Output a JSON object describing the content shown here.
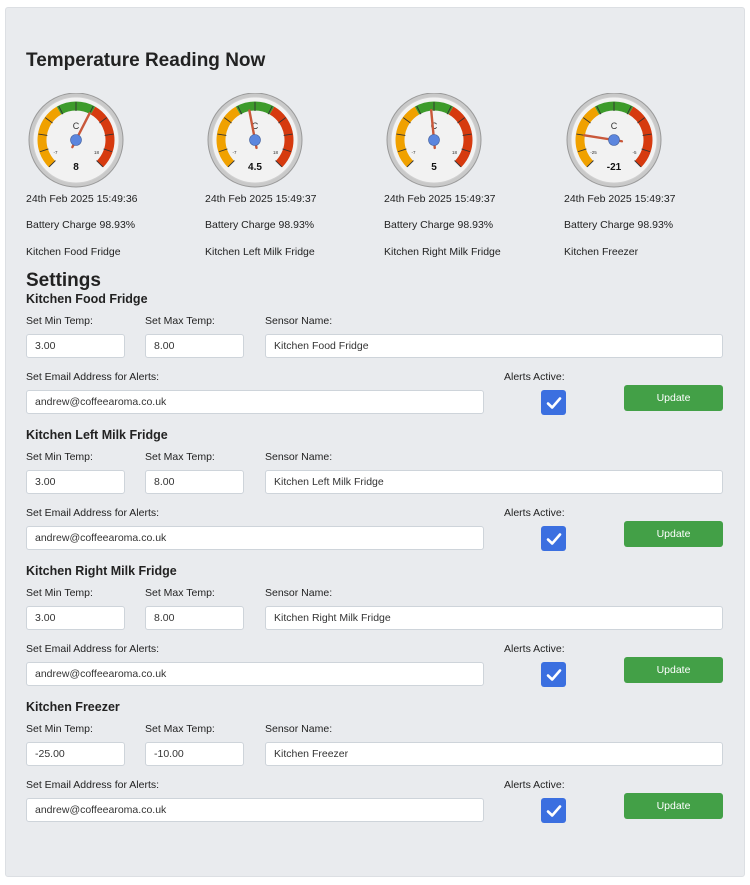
{
  "page_title": "Temperature Reading Now",
  "settings_title": "Settings",
  "gauges": [
    {
      "unit": "C",
      "value": 8,
      "value_label": "8",
      "min_label": "-7",
      "max_label": "18",
      "timestamp": "24th Feb 2025 15:49:36",
      "battery": "Battery Charge 98.93%",
      "name": "Kitchen Food Fridge"
    },
    {
      "unit": "C",
      "value": 4.5,
      "value_label": "4.5",
      "min_label": "-7",
      "max_label": "18",
      "timestamp": "24th Feb 2025 15:49:37",
      "battery": "Battery Charge 98.93%",
      "name": "Kitchen Left Milk Fridge"
    },
    {
      "unit": "C",
      "value": 5,
      "value_label": "5",
      "min_label": "-7",
      "max_label": "18",
      "timestamp": "24th Feb 2025 15:49:37",
      "battery": "Battery Charge 98.93%",
      "name": "Kitchen Right Milk Fridge"
    },
    {
      "unit": "C",
      "value": -21,
      "value_label": "-21",
      "min_label": "-25",
      "max_label": "-5",
      "timestamp": "24th Feb 2025 15:49:37",
      "battery": "Battery Charge 98.93%",
      "name": "Kitchen Freezer"
    }
  ],
  "labels": {
    "min_temp": "Set Min Temp:",
    "max_temp": "Set Max Temp:",
    "sensor_name": "Sensor Name:",
    "email": "Set Email Address for Alerts:",
    "alerts_active": "Alerts Active:",
    "update": "Update"
  },
  "sensors": [
    {
      "title": "Kitchen Food Fridge",
      "min": "3.00",
      "max": "8.00",
      "sensor_name": "Kitchen Food Fridge",
      "email": "andrew@coffeearoma.co.uk",
      "alerts_active": true
    },
    {
      "title": "Kitchen Left Milk Fridge",
      "min": "3.00",
      "max": "8.00",
      "sensor_name": "Kitchen Left Milk Fridge",
      "email": "andrew@coffeearoma.co.uk",
      "alerts_active": true
    },
    {
      "title": "Kitchen Right Milk Fridge",
      "min": "3.00",
      "max": "8.00",
      "sensor_name": "Kitchen Right Milk Fridge",
      "email": "andrew@coffeearoma.co.uk",
      "alerts_active": true
    },
    {
      "title": "Kitchen Freezer",
      "min": "-25.00",
      "max": "-10.00",
      "sensor_name": "Kitchen Freezer",
      "email": "andrew@coffeearoma.co.uk",
      "alerts_active": true
    }
  ],
  "colors": {
    "button": "#43a047",
    "checkbox": "#3b6fe0",
    "gauge_green": "#3d9b2b",
    "gauge_orange": "#f0a100",
    "gauge_red": "#d63a0f"
  }
}
